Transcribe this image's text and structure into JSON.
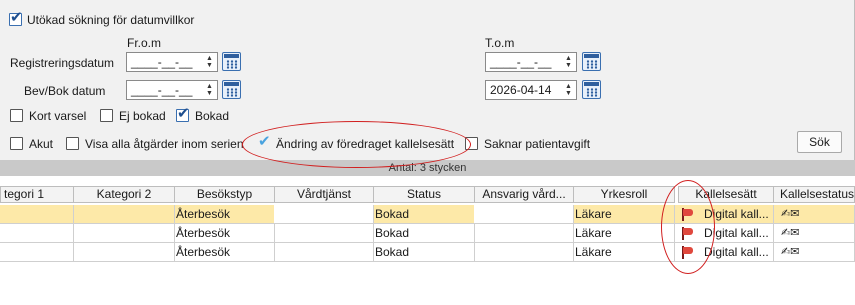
{
  "filters": {
    "extended_search": {
      "label": "Utökad sökning för datumvillkor",
      "checked": true
    },
    "from_header": "Fr.o.m",
    "to_header": "T.o.m",
    "registration_date": {
      "label": "Registreringsdatum",
      "from": "____-__-__",
      "to": "____-__-__"
    },
    "booking_date": {
      "label": "Bev/Bok datum",
      "from": "____-__-__",
      "to": "2026-04-14"
    },
    "kort_varsel": {
      "label": "Kort varsel",
      "checked": false
    },
    "ej_bokad": {
      "label": "Ej bokad",
      "checked": false
    },
    "bokad": {
      "label": "Bokad",
      "checked": true
    },
    "akut": {
      "label": "Akut",
      "checked": false
    },
    "visa_alla": {
      "label": "Visa alla åtgärder inom serien",
      "checked": false
    },
    "andring": {
      "label": "Ändring av föredraget kallelsesätt",
      "checked": true
    },
    "saknar": {
      "label": "Saknar patientavgift",
      "checked": false
    },
    "search_button": "Sök",
    "count_text": "Antal: 3 stycken"
  },
  "table": {
    "headers": [
      "tegori 1",
      "Kategori 2",
      "Besökstyp",
      "Vårdtjänst",
      "Status",
      "Ansvarig vård...",
      "Yrkesroll",
      "Kallelsesätt",
      "Kallelsestatus"
    ],
    "rows": [
      {
        "kategori1": "",
        "kategori2": "",
        "besokstyp": "Återbesök",
        "vardtjanst": "",
        "status": "Bokad",
        "ansvarig": "",
        "yrkesroll": "Läkare",
        "kallelsesatt": "Digital kall...",
        "selected": true
      },
      {
        "kategori1": "",
        "kategori2": "",
        "besokstyp": "Återbesök",
        "vardtjanst": "",
        "status": "Bokad",
        "ansvarig": "",
        "yrkesroll": "Läkare",
        "kallelsesatt": "Digital kall...",
        "selected": false
      },
      {
        "kategori1": "",
        "kategori2": "",
        "besokstyp": "Återbesök",
        "vardtjanst": "",
        "status": "Bokad",
        "ansvarig": "",
        "yrkesroll": "Läkare",
        "kallelsesatt": "Digital kall...",
        "selected": false
      }
    ]
  },
  "icons": {
    "checkbox_tick": "check-icon",
    "calendar": "calendar-icon",
    "flag": "red-flag-icon",
    "status": "hand-envelope-icon"
  },
  "colors": {
    "selected_row": "#fde9a8",
    "annotation": "#d11f1f",
    "accent": "#2f5f9e"
  }
}
